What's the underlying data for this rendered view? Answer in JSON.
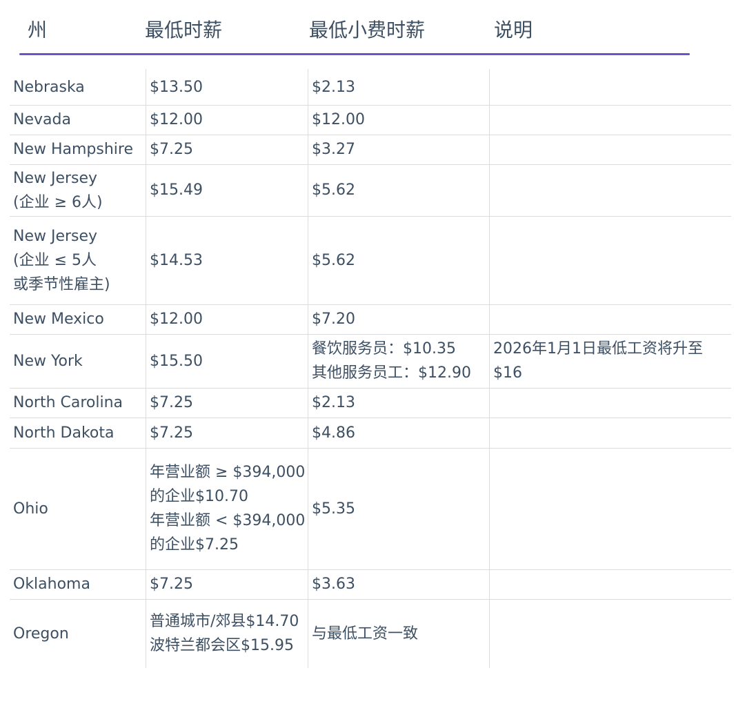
{
  "headers": [
    "州",
    "最低时薪",
    "最低小费时薪",
    "说明"
  ],
  "rows": [
    {
      "state": "Nebraska",
      "min": "$13.50",
      "tip": "$2.13",
      "note": ""
    },
    {
      "state": "Nevada",
      "min": "$12.00",
      "tip": "$12.00",
      "note": ""
    },
    {
      "state": "New Hampshire",
      "min": "$7.25",
      "tip": "$3.27",
      "note": ""
    },
    {
      "state": "New Jersey\n (企业 ≥ 6人)",
      "min": "$15.49",
      "tip": "$5.62",
      "note": ""
    },
    {
      "state": "New Jersey\n(企业 ≤ 5人\n或季节性雇主)",
      "min": "$14.53",
      "tip": "$5.62",
      "note": ""
    },
    {
      "state": "New Mexico",
      "min": "$12.00",
      "tip": "$7.20",
      "note": ""
    },
    {
      "state": "New York",
      "min": "$15.50",
      "tip": "餐饮服务员：$10.35\n其他服务员工：$12.90",
      "note": "2026年1月1日最低工资将升至\n$16"
    },
    {
      "state": "North Carolina",
      "min": "$7.25",
      "tip": "$2.13",
      "note": ""
    },
    {
      "state": "North Dakota",
      "min": "$7.25",
      "tip": "$4.86",
      "note": ""
    },
    {
      "state": "Ohio",
      "min": "年营业额 ≥ $394,000\n的企业$10.70\n年营业额 < $394,000\n的企业$7.25",
      "tip": "$5.35",
      "note": ""
    },
    {
      "state": "Oklahoma",
      "min": "$7.25",
      "tip": "$3.63",
      "note": ""
    },
    {
      "state": "Oregon",
      "min": "普通城市/郊县$14.70\n波特兰都会区$15.95",
      "tip": "与最低工资一致",
      "note": ""
    }
  ]
}
